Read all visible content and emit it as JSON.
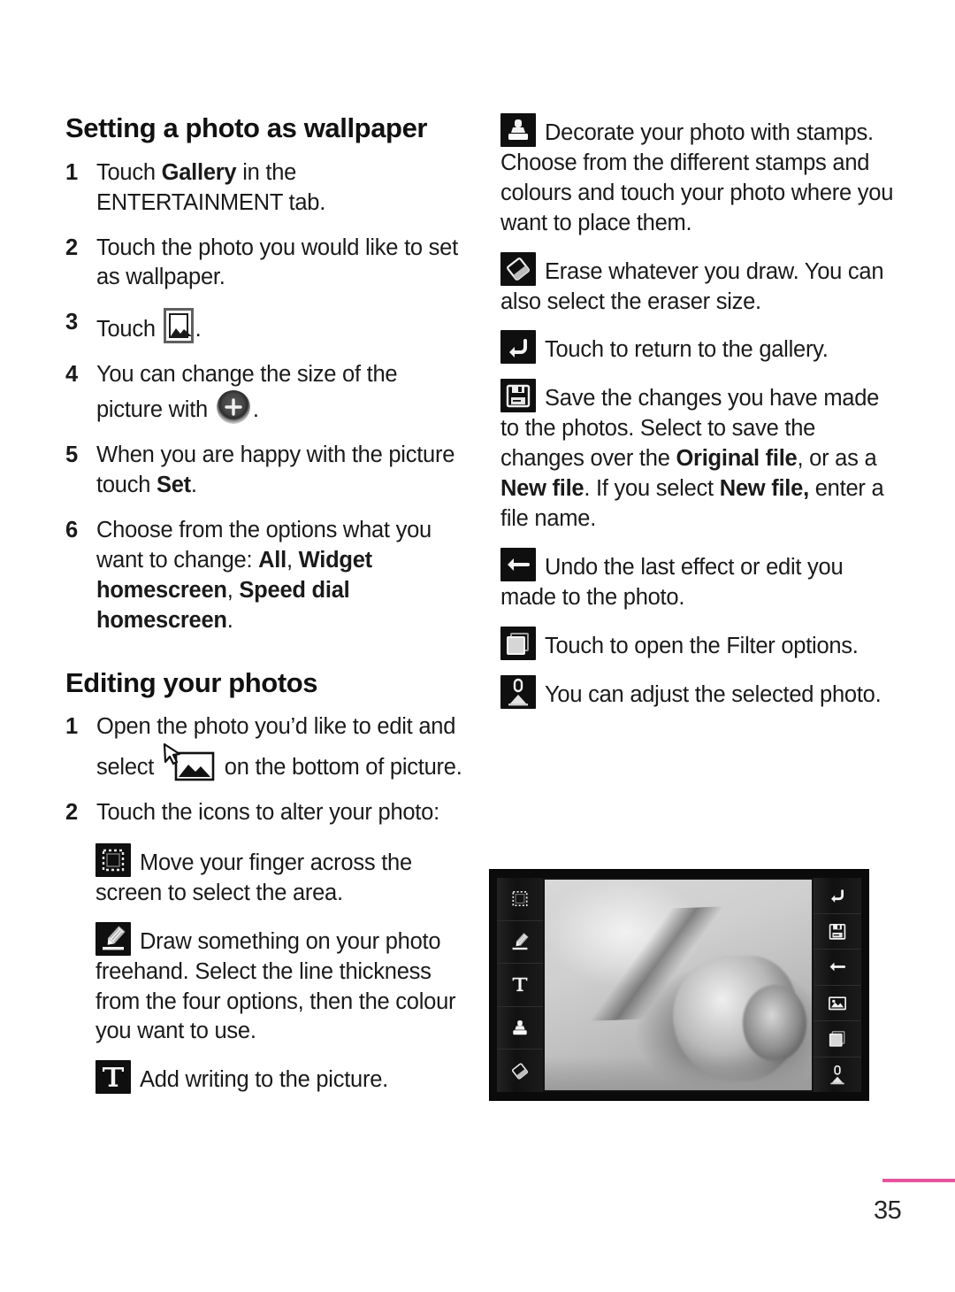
{
  "page": {
    "number": "35",
    "accent_color": "#e5559e",
    "text_color": "#1a1a1a"
  },
  "left_column": {
    "section1": {
      "title": "Setting a photo as wallpaper",
      "steps": [
        {
          "num": "1",
          "parts": [
            {
              "t": "Touch ",
              "b": false
            },
            {
              "t": "Gallery",
              "b": true
            },
            {
              "t": " in the ENTERTAINMENT tab.",
              "b": false
            }
          ]
        },
        {
          "num": "2",
          "parts": [
            {
              "t": "Touch the photo you would like to set as wallpaper.",
              "b": false
            }
          ]
        },
        {
          "num": "3",
          "parts": [
            {
              "t": "Touch ",
              "b": false
            },
            {
              "icon": "picture-frame-icon"
            },
            {
              "t": ".",
              "b": false
            }
          ]
        },
        {
          "num": "4",
          "parts": [
            {
              "t": "You can change the size of the picture with ",
              "b": false
            },
            {
              "icon": "plus-circle-icon"
            },
            {
              "t": ".",
              "b": false
            }
          ]
        },
        {
          "num": "5",
          "parts": [
            {
              "t": "When you are happy with the picture touch ",
              "b": false
            },
            {
              "t": "Set",
              "b": true
            },
            {
              "t": ".",
              "b": false
            }
          ]
        },
        {
          "num": "6",
          "parts": [
            {
              "t": "Choose from the options what you want to change: ",
              "b": false
            },
            {
              "t": "All",
              "b": true
            },
            {
              "t": ", ",
              "b": false
            },
            {
              "t": "Widget homescreen",
              "b": true
            },
            {
              "t": ", ",
              "b": false
            },
            {
              "t": "Speed dial homescreen",
              "b": true
            },
            {
              "t": ".",
              "b": false
            }
          ]
        }
      ]
    },
    "section2": {
      "title": "Editing your photos",
      "steps": [
        {
          "num": "1",
          "parts": [
            {
              "t": "Open the photo you’d like to edit and select ",
              "b": false
            },
            {
              "icon": "cursor-picture-icon"
            },
            {
              "t": " on the bottom of picture.",
              "b": false
            }
          ]
        },
        {
          "num": "2",
          "parts": [
            {
              "t": "Touch the icons to alter your photo:",
              "b": false
            }
          ]
        }
      ],
      "icon_items": [
        {
          "icon": "selection-crop-icon",
          "parts": [
            {
              "t": "Move your finger across the screen to select the area.",
              "b": false
            }
          ]
        },
        {
          "icon": "pencil-icon",
          "parts": [
            {
              "t": "Draw something on your photo freehand. Select the line thickness from the four options, then the colour you want to use.",
              "b": false
            }
          ]
        },
        {
          "icon": "text-tool-icon",
          "parts": [
            {
              "t": "Add writing to the picture.",
              "b": false
            }
          ]
        }
      ]
    }
  },
  "right_column": {
    "icon_items": [
      {
        "icon": "stamp-icon",
        "parts": [
          {
            "t": "Decorate your photo with stamps. Choose from the different stamps and colours and touch your photo where you want to place them.",
            "b": false
          }
        ]
      },
      {
        "icon": "eraser-icon",
        "parts": [
          {
            "t": "Erase whatever you draw. You can also select the eraser size.",
            "b": false
          }
        ]
      },
      {
        "icon": "return-gallery-icon",
        "parts": [
          {
            "t": "Touch to return to the gallery.",
            "b": false
          }
        ]
      },
      {
        "icon": "save-icon",
        "parts": [
          {
            "t": "Save the changes you have made to the photos. Select to save the changes over the ",
            "b": false
          },
          {
            "t": "Original file",
            "b": true
          },
          {
            "t": ", or as a ",
            "b": false
          },
          {
            "t": "New file",
            "b": true
          },
          {
            "t": ". If you select ",
            "b": false
          },
          {
            "t": "New file,",
            "b": true
          },
          {
            "t": " enter a file name.",
            "b": false
          }
        ]
      },
      {
        "icon": "undo-arrow-icon",
        "parts": [
          {
            "t": "Undo the last effect or edit you made to the photo.",
            "b": false
          }
        ]
      },
      {
        "icon": "filter-icon",
        "parts": [
          {
            "t": "Touch to open the Filter options.",
            "b": false
          }
        ]
      },
      {
        "icon": "adjust-icon",
        "parts": [
          {
            "t": "You can adjust the selected photo.",
            "b": false
          }
        ]
      }
    ],
    "screenshot": {
      "left_toolbar_icons": [
        "selection-crop-icon",
        "pencil-icon",
        "text-tool-icon",
        "stamp-icon",
        "eraser-icon"
      ],
      "right_toolbar_icons": [
        "return-gallery-icon",
        "save-icon",
        "undo-arrow-icon",
        "wallpaper-icon",
        "filter-icon",
        "adjust-icon"
      ]
    }
  }
}
